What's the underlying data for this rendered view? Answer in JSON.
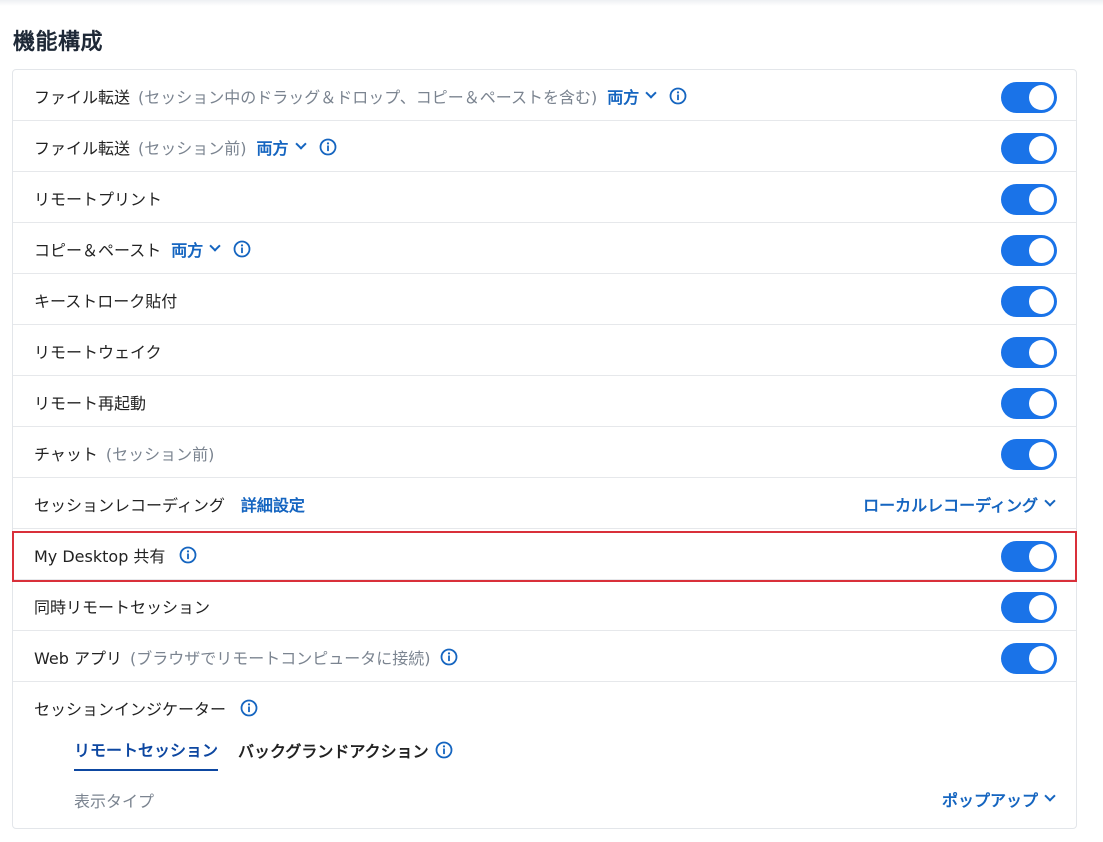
{
  "section_title": "機能構成",
  "rows": [
    {
      "label": "ファイル転送",
      "sub": "(セッション中のドラッグ＆ドロップ、コピー＆ペーストを含む)",
      "dropdown": "両方",
      "toggle": true
    },
    {
      "label": "ファイル転送",
      "sub": "(セッション前)",
      "dropdown": "両方",
      "toggle": true
    },
    {
      "label": "リモートプリント",
      "toggle": true
    },
    {
      "label": "コピー＆ペースト",
      "dropdown": "両方",
      "toggle": true
    },
    {
      "label": "キーストローク貼付",
      "toggle": true
    },
    {
      "label": "リモートウェイク",
      "toggle": true
    },
    {
      "label": "リモート再起動",
      "toggle": true
    },
    {
      "label": "チャット",
      "sub": "(セッション前)",
      "toggle": true
    },
    {
      "label": "セッションレコーディング",
      "link": "詳細設定",
      "right_dropdown": "ローカルレコーディング"
    },
    {
      "label": "My Desktop 共有",
      "toggle": true,
      "highlighted": true
    },
    {
      "label": "同時リモートセッション",
      "toggle": true
    },
    {
      "label": "Web アプリ",
      "sub": "(ブラウザでリモートコンピュータに接続)",
      "toggle": true
    }
  ],
  "indicator": {
    "label": "セッションインジケーター",
    "tabs": [
      "リモートセッション",
      "バックグランドアクション"
    ],
    "active_tab": "リモートセッション",
    "display_type_label": "表示タイプ",
    "display_type_value": "ポップアップ"
  },
  "colors": {
    "accent": "#1a73e8",
    "link": "#1565c0",
    "highlight_border": "#d9303a"
  }
}
